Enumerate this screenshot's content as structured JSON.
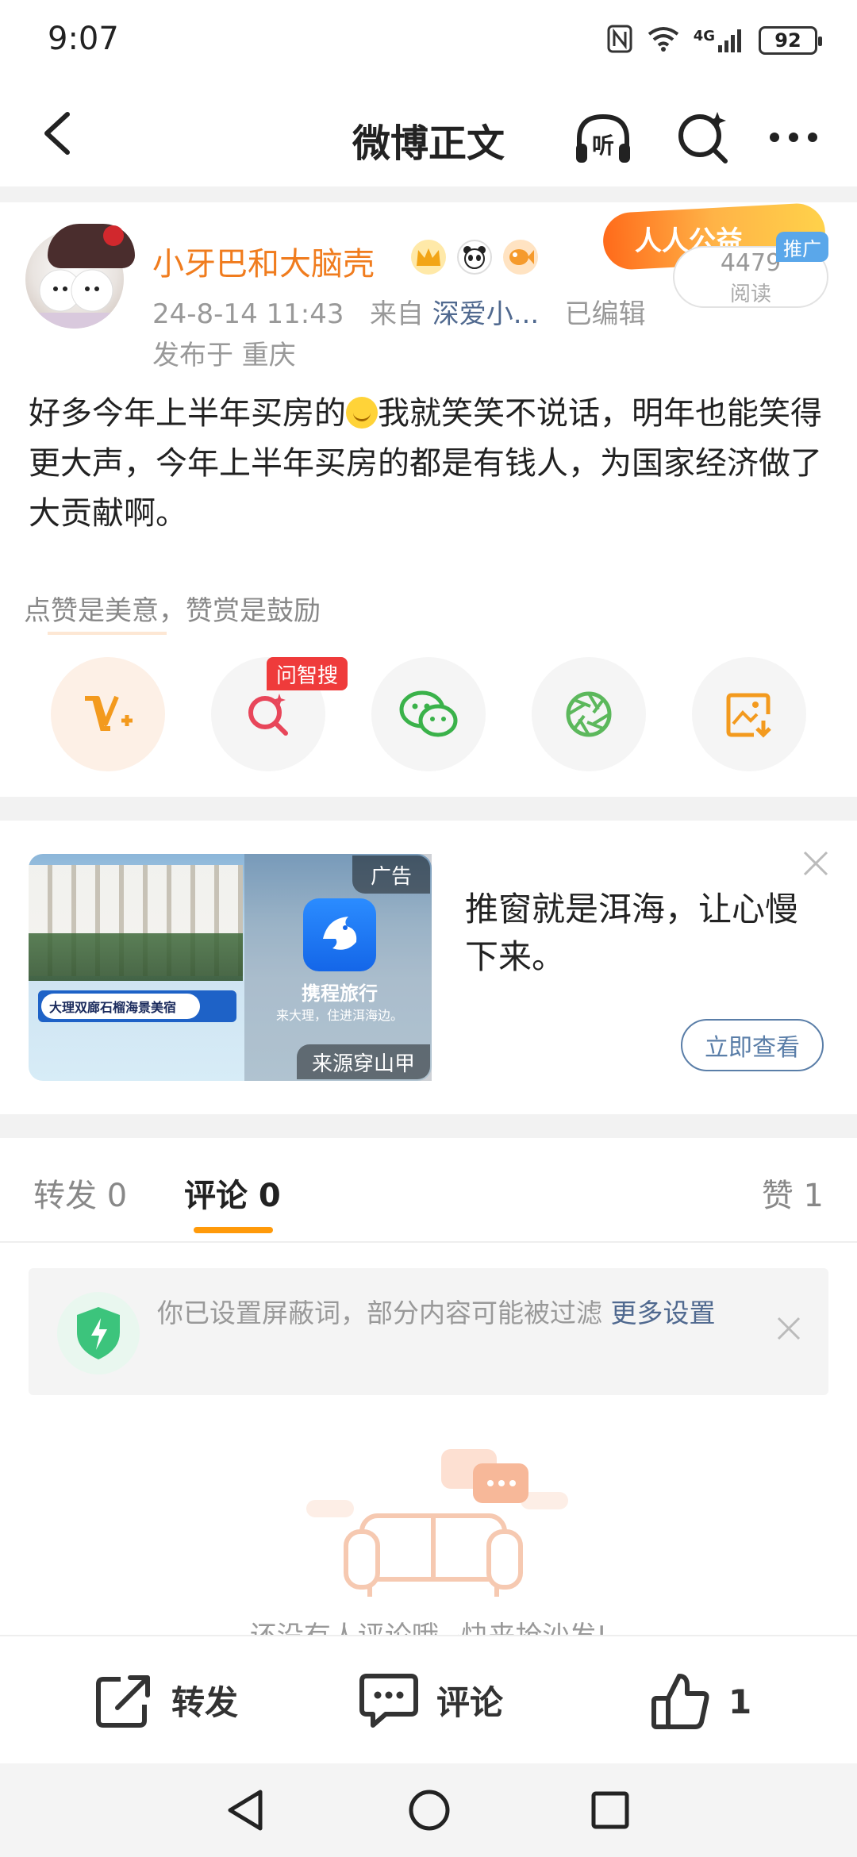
{
  "status_bar": {
    "time": "9:07",
    "network": "4G",
    "battery": "92"
  },
  "nav": {
    "title": "微博正文"
  },
  "post": {
    "username": "小牙巴和大脑壳",
    "date": "24-8-14 11:43",
    "source_prefix": "来自",
    "source": "深爱小...",
    "edited": "已编辑",
    "location": "发布于 重庆",
    "promo_banner": "人人公益",
    "views": "4479",
    "views_label": "阅读",
    "promoted_tag": "推广",
    "text_part1": "好多今年上半年买房的",
    "text_part2": "我就笑笑不说话，明年也能笑得更大声，今年上半年买房的都是有钱人，为国家经济做了大贡献啊。",
    "reward_hint": "点赞是美意，赞赏是鼓励",
    "zhisou_tag": "问智搜"
  },
  "ad": {
    "label": "广告",
    "source": "来源穿山甲",
    "app_name": "携程旅行",
    "app_subtitle": "来大理，住进洱海边。",
    "search_text": "大理双廊石榴海景美宿",
    "title": "推窗就是洱海，让心慢下来。",
    "cta": "立即查看"
  },
  "tabs": {
    "repost": "转发 0",
    "comment": "评论 0",
    "like": "赞 1"
  },
  "filter_notice": {
    "text": "你已设置屏蔽词，部分内容可能被过滤 ",
    "link": "更多设置"
  },
  "empty_state": {
    "text": "还没有人评论哦~快来抢沙发!"
  },
  "bottom_bar": {
    "repost": "转发",
    "comment": "评论",
    "like_count": "1"
  },
  "colors": {
    "accent": "#ff9a0a",
    "username": "#f07c1e",
    "link": "#50698f"
  }
}
